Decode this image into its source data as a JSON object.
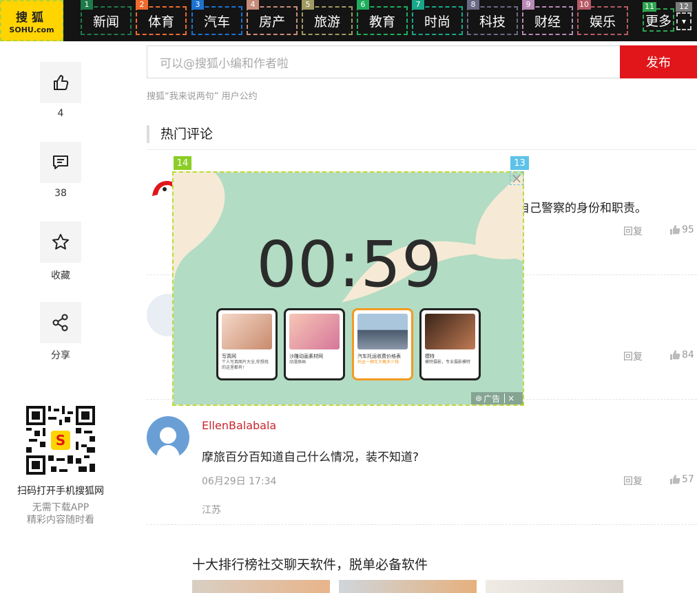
{
  "logo": {
    "line1": "搜狐",
    "line2": "SOHU.com"
  },
  "nav": [
    {
      "label": "新闻",
      "num": "1",
      "color": "#1f7a4a"
    },
    {
      "label": "体育",
      "num": "2",
      "color": "#ee6b2d"
    },
    {
      "label": "汽车",
      "num": "3",
      "color": "#1d72cf"
    },
    {
      "label": "房产",
      "num": "4",
      "color": "#c88c7a"
    },
    {
      "label": "旅游",
      "num": "5",
      "color": "#a19a62"
    },
    {
      "label": "教育",
      "num": "6",
      "color": "#1fae5e"
    },
    {
      "label": "时尚",
      "num": "7",
      "color": "#19a889"
    },
    {
      "label": "科技",
      "num": "8",
      "color": "#6a6a86"
    },
    {
      "label": "财经",
      "num": "9",
      "color": "#b88ab5"
    },
    {
      "label": "娱乐",
      "num": "10",
      "color": "#b75a66"
    }
  ],
  "more": {
    "label": "更多",
    "num": "11",
    "arrow_num": "12",
    "arrow": "▾"
  },
  "sidebar": {
    "like_count": "4",
    "comment_count": "38",
    "favorite_label": "收藏",
    "share_label": "分享"
  },
  "comment_box": {
    "placeholder": "可以@搜狐小编和作者啦",
    "publish": "发布",
    "agreement": "搜狐“我来说两句” 用户公约"
  },
  "hot_title": "热门评论",
  "comments": [
    {
      "partial_text": "自己警察的身份和职责。",
      "reply": "回复",
      "likes": "95"
    },
    {
      "reply": "回复",
      "likes": "84"
    },
    {
      "username": "EllenBalabala",
      "text": "摩旅百分百知道自己什么情况，装不知道?",
      "time": "06月29日 17:34",
      "location": "江苏",
      "reply": "回复",
      "likes": "57"
    }
  ],
  "qr": {
    "main": "扫码打开手机搜狐网",
    "sub1": "无需下载APP",
    "sub2": "精彩内容随时看"
  },
  "rank_title": "十大排行榜社交聊天软件，脱单必备软件",
  "ad": {
    "badge_left": "14",
    "badge_right": "13",
    "timer": "00:59",
    "mark": "广告",
    "cards": [
      {
        "t1": "写真网",
        "t2": "个人写真图片大全,你想找的这里都有!"
      },
      {
        "t1": "沙雕动画素材网",
        "t2": "动漫原画"
      },
      {
        "t1": "汽车托运收费价格表",
        "t2": "托运一辆车大概多少钱"
      },
      {
        "t1": "模特",
        "t2": "模特摄影，专业摄影模特"
      }
    ]
  }
}
